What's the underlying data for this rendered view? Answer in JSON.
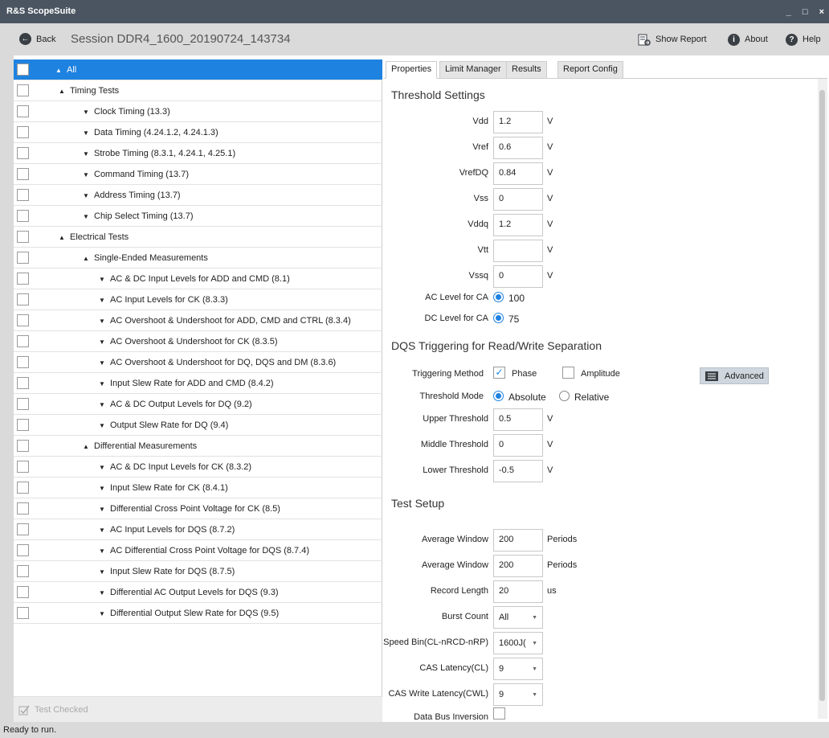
{
  "window": {
    "title": "R&S ScopeSuite",
    "controls": [
      "_",
      "□",
      "×"
    ]
  },
  "toolbar": {
    "back": "Back",
    "session": "Session  DDR4_1600_20190724_143734",
    "show_report": "Show Report",
    "about": "About",
    "help": "Help"
  },
  "tree": {
    "items": [
      {
        "label": "All",
        "level": 0,
        "expanded": true,
        "selected": true
      },
      {
        "label": "Timing Tests",
        "level": 1,
        "expanded": true
      },
      {
        "label": "Clock Timing (13.3)",
        "level": 2,
        "expanded": false
      },
      {
        "label": "Data Timing (4.24.1.2, 4.24.1.3)",
        "level": 2,
        "expanded": false
      },
      {
        "label": "Strobe Timing (8.3.1, 4.24.1, 4.25.1)",
        "level": 2,
        "expanded": false
      },
      {
        "label": "Command Timing (13.7)",
        "level": 2,
        "expanded": false
      },
      {
        "label": "Address Timing (13.7)",
        "level": 2,
        "expanded": false
      },
      {
        "label": "Chip Select Timing (13.7)",
        "level": 2,
        "expanded": false
      },
      {
        "label": "Electrical Tests",
        "level": 1,
        "expanded": true
      },
      {
        "label": "Single-Ended Measurements",
        "level": 2,
        "expanded": true
      },
      {
        "label": "AC & DC Input Levels for ADD and CMD (8.1)",
        "level": 3,
        "expanded": false
      },
      {
        "label": "AC Input Levels for CK (8.3.3)",
        "level": 3,
        "expanded": false
      },
      {
        "label": "AC Overshoot & Undershoot for ADD, CMD and CTRL (8.3.4)",
        "level": 3,
        "expanded": false
      },
      {
        "label": "AC Overshoot & Undershoot for CK (8.3.5)",
        "level": 3,
        "expanded": false
      },
      {
        "label": "AC Overshoot & Undershoot for DQ, DQS and DM (8.3.6)",
        "level": 3,
        "expanded": false
      },
      {
        "label": "Input Slew Rate for ADD and CMD (8.4.2)",
        "level": 3,
        "expanded": false
      },
      {
        "label": "AC & DC Output Levels for DQ (9.2)",
        "level": 3,
        "expanded": false
      },
      {
        "label": "Output Slew Rate for DQ (9.4)",
        "level": 3,
        "expanded": false
      },
      {
        "label": "Differential Measurements",
        "level": 2,
        "expanded": true
      },
      {
        "label": "AC & DC Input Levels for CK (8.3.2)",
        "level": 3,
        "expanded": false
      },
      {
        "label": "Input Slew Rate for CK (8.4.1)",
        "level": 3,
        "expanded": false
      },
      {
        "label": "Differential Cross Point Voltage for CK (8.5)",
        "level": 3,
        "expanded": false
      },
      {
        "label": "AC Input Levels for DQS (8.7.2)",
        "level": 3,
        "expanded": false
      },
      {
        "label": "AC Differential Cross Point Voltage for DQS (8.7.4)",
        "level": 3,
        "expanded": false
      },
      {
        "label": "Input Slew Rate for DQS (8.7.5)",
        "level": 3,
        "expanded": false
      },
      {
        "label": "Differential AC Output Levels for DQS (9.3)",
        "level": 3,
        "expanded": false
      },
      {
        "label": "Differential Output Slew Rate for DQS (9.5)",
        "level": 3,
        "expanded": false
      }
    ],
    "test_checked": "Test Checked"
  },
  "tabs": [
    "Properties",
    "Limit Manager",
    "Results",
    "Report Config"
  ],
  "threshold": {
    "title": "Threshold Settings",
    "fields": [
      {
        "label": "Vdd",
        "value": "1.2",
        "unit": "V"
      },
      {
        "label": "Vref",
        "value": "0.6",
        "unit": "V"
      },
      {
        "label": "VrefDQ",
        "value": "0.84",
        "unit": "V"
      },
      {
        "label": "Vss",
        "value": "0",
        "unit": "V"
      },
      {
        "label": "Vddq",
        "value": "1.2",
        "unit": "V"
      },
      {
        "label": "Vtt",
        "value": "",
        "unit": "V"
      },
      {
        "label": "Vssq",
        "value": "0",
        "unit": "V"
      }
    ],
    "ac_label": "AC Level for CA",
    "ac_value": "100",
    "dc_label": "DC Level for CA",
    "dc_value": "75"
  },
  "dqs": {
    "title": "DQS Triggering for Read/Write Separation",
    "trig_label": "Triggering Method",
    "phase": "Phase",
    "amplitude": "Amplitude",
    "advanced": "Advanced",
    "mode_label": "Threshold Mode",
    "absolute": "Absolute",
    "relative": "Relative",
    "fields": [
      {
        "label": "Upper Threshold",
        "value": "0.5",
        "unit": "V"
      },
      {
        "label": "Middle Threshold",
        "value": "0",
        "unit": "V"
      },
      {
        "label": "Lower Threshold",
        "value": "-0.5",
        "unit": "V"
      }
    ]
  },
  "setup": {
    "title": "Test Setup",
    "avg1_label": "Average Window",
    "avg1_value": "200",
    "avg1_unit": "Periods",
    "avg2_label": "Average Window",
    "avg2_value": "200",
    "avg2_unit": "Periods",
    "rec_label": "Record Length",
    "rec_value": "20",
    "rec_unit": "us",
    "burst_label": "Burst Count",
    "burst_value": "All",
    "speed_label": "Speed Bin(CL-nRCD-nRP)",
    "speed_value": "1600J(",
    "cas_label": "CAS Latency(CL)",
    "cas_value": "9",
    "cwl_label": "CAS Write Latency(CWL)",
    "cwl_value": "9",
    "dbi_label": "Data Bus Inversion"
  },
  "status": "Ready to run."
}
